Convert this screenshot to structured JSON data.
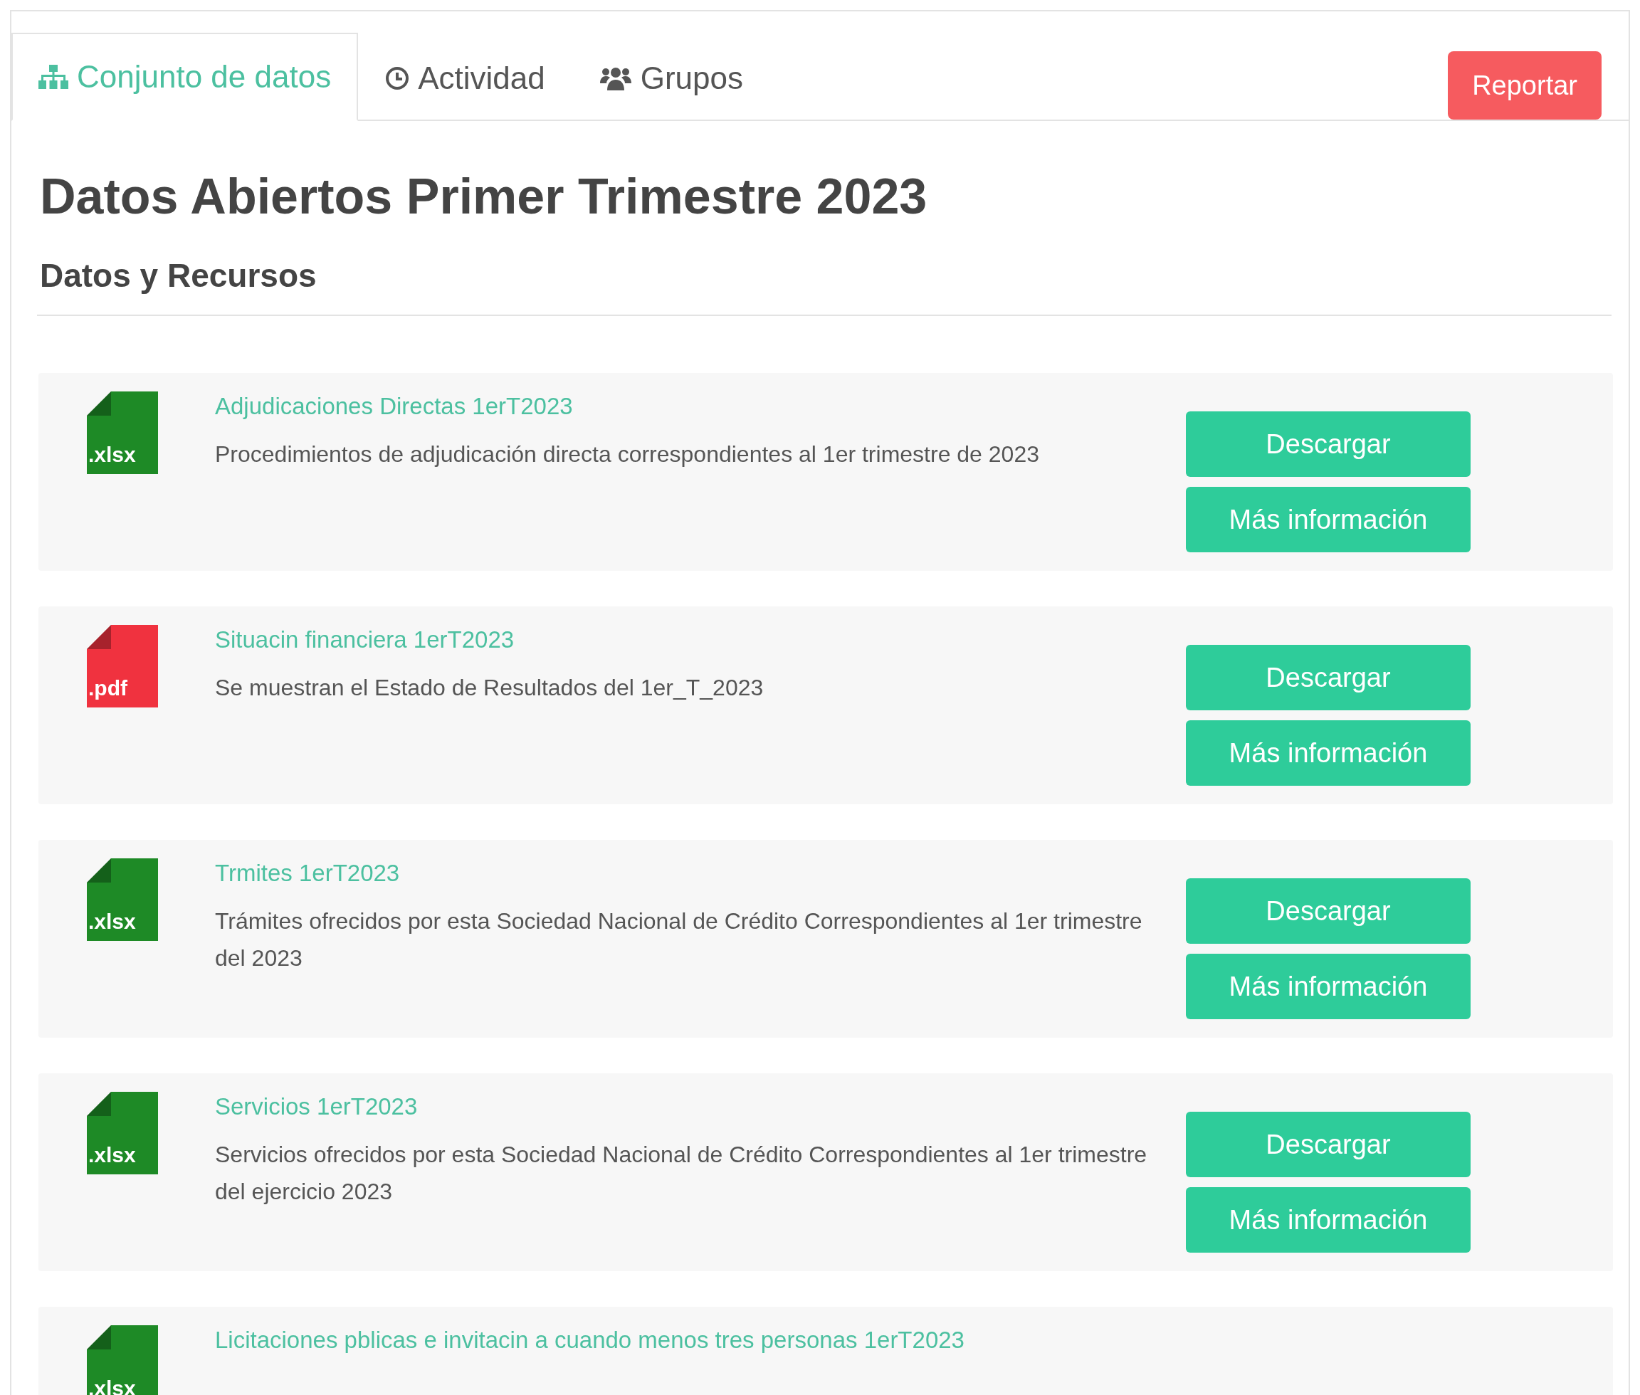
{
  "tabs": [
    {
      "label": "Conjunto de datos",
      "selected": true
    },
    {
      "label": "Actividad",
      "selected": false
    },
    {
      "label": "Grupos",
      "selected": false
    }
  ],
  "report_button": "Reportar",
  "title": "Datos Abiertos Primer Trimestre 2023",
  "section_heading": "Datos y Recursos",
  "resources": [
    {
      "color": "#1e8a26",
      "format_label": ".xlsx",
      "name": "Adjudicaciones Directas 1erT2023",
      "description": "Procedimientos de adjudicación directa correspondientes al 1er trimestre de 2023",
      "buttons": [
        "Descargar",
        "Más información"
      ]
    },
    {
      "color": "#f0323f",
      "format_label": ".pdf",
      "name": "Situacin financiera 1erT2023",
      "description": "Se muestran el Estado de Resultados del 1er_T_2023",
      "buttons": [
        "Descargar",
        "Más información"
      ]
    },
    {
      "color": "#1e8a26",
      "format_label": ".xlsx",
      "name": "Trmites 1erT2023",
      "description": "Trámites ofrecidos por esta Sociedad Nacional de Crédito Correspondientes al 1er trimestre del 2023",
      "buttons": [
        "Descargar",
        "Más información"
      ]
    },
    {
      "color": "#1e8a26",
      "format_label": ".xlsx",
      "name": "Servicios 1erT2023",
      "description": "Servicios ofrecidos por esta Sociedad Nacional de Crédito Correspondientes al 1er trimestre del ejercicio 2023",
      "buttons": [
        "Descargar",
        "Más información"
      ]
    },
    {
      "color": "#1e8a26",
      "format_label": ".xlsx",
      "name": "Licitaciones pblicas e invitacin a cuando menos tres personas 1erT2023"
    }
  ]
}
